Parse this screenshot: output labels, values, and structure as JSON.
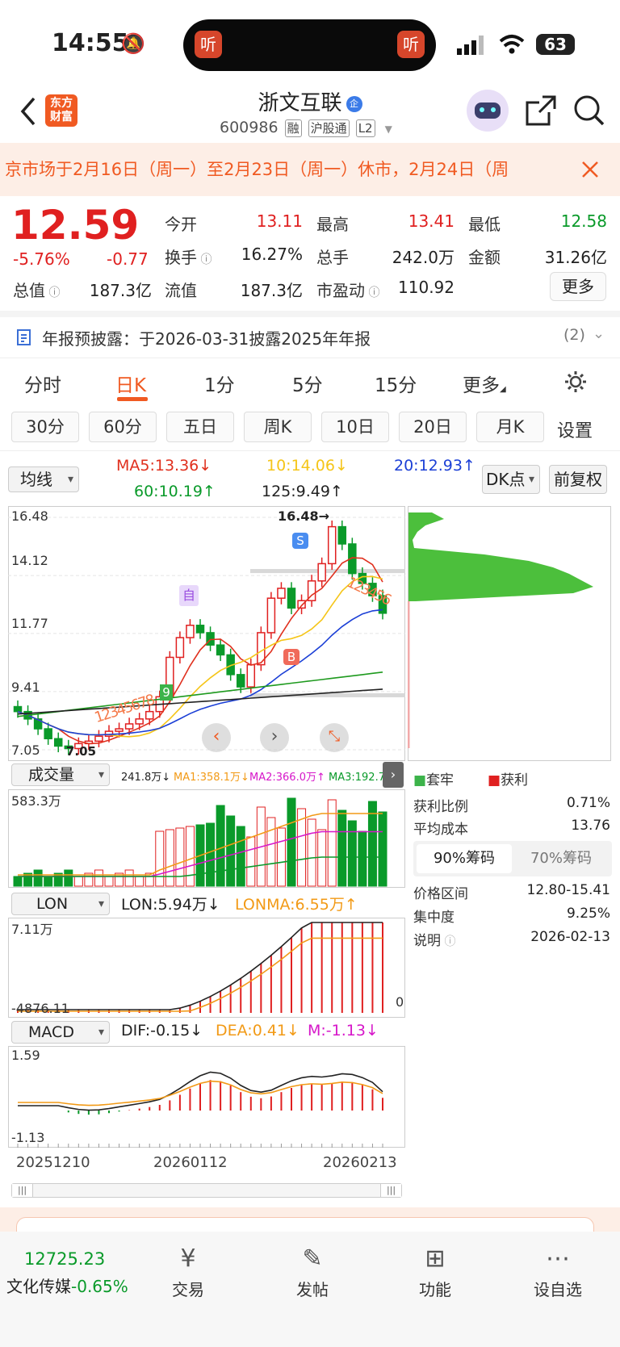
{
  "status": {
    "time": "14:55",
    "battery": "63",
    "island_left": "听",
    "island_right": "听"
  },
  "header": {
    "logo_line1": "东方",
    "logo_line2": "财富",
    "title": "浙文互联",
    "title_badge": "企",
    "code": "600986",
    "tags": [
      "融",
      "沪股通",
      "L2"
    ]
  },
  "notice": {
    "text": "京市场于2月16日（周一）至2月23日（周一）休市，2月24日（周"
  },
  "quote": {
    "price": "12.59",
    "pct": "-5.76%",
    "chg": "-0.77",
    "open_label": "今开",
    "open": "13.11",
    "high_label": "最高",
    "high": "13.41",
    "low_label": "最低",
    "low": "12.58",
    "turnover_label": "换手",
    "turnover": "16.27%",
    "volume_label": "总手",
    "volume": "242.0万",
    "amount_label": "金额",
    "amount": "31.26亿",
    "mcap_label": "总值",
    "mcap": "187.3亿",
    "float_label": "流值",
    "float": "187.3亿",
    "pe_label": "市盈动",
    "pe": "110.92",
    "more_button": "更多"
  },
  "report": {
    "text": "年报预披露：于2026-03-31披露2025年年报",
    "count": "(2)"
  },
  "period_tabs": [
    "分时",
    "日K",
    "1分",
    "5分",
    "15分",
    "更多"
  ],
  "active_period": "日K",
  "ktabs": [
    "30分",
    "60分",
    "五日",
    "周K",
    "10日",
    "20日",
    "月K"
  ],
  "settings_label": "设置",
  "ma_bar": {
    "selector": "均线",
    "ma5": "MA5:13.36↓",
    "ma10": "10:14.06↓",
    "ma20": "20:12.93↑",
    "ma60": "60:10.19↑",
    "ma125": "125:9.49↑",
    "dk": "DK点",
    "fq": "前复权"
  },
  "price_axis": [
    "16.48",
    "14.12",
    "11.77",
    "9.41",
    "7.05"
  ],
  "annotations": {
    "peak": "16.48→",
    "low": "7.05",
    "self": "自",
    "s": "S",
    "b": "B",
    "nine": "9",
    "seq_bottom": "12345678",
    "seq_top": "123456"
  },
  "volume_bar": {
    "selector": "成交量",
    "vol": "241.8万↓",
    "ma1": "MA1:358.1万↓",
    "ma2": "MA2:366.0万↑",
    "ma3": "MA3:192.7万↑",
    "max": "583.3万"
  },
  "lon_bar": {
    "selector": "LON",
    "lon": "LON:5.94万↓",
    "lonma": "LONMA:6.55万↑",
    "max": "7.11万",
    "min": "-4876.11",
    "zero": "0"
  },
  "macd_bar": {
    "selector": "MACD",
    "dif": "DIF:-0.15↓",
    "dea": "DEA:0.41↓",
    "m": "M:-1.13↓",
    "max": "1.59",
    "min": "-1.13"
  },
  "dates": [
    "20251210",
    "20260112",
    "20260213"
  ],
  "right_panel": {
    "legend_trapped": "套牢",
    "legend_profit": "获利",
    "profit_ratio_label": "获利比例",
    "profit_ratio": "0.71%",
    "avg_cost_label": "平均成本",
    "avg_cost": "13.76",
    "tab_90": "90%筹码",
    "tab_70": "70%筹码",
    "range_label": "价格区间",
    "range": "12.80-15.41",
    "conc_label": "集中度",
    "conc": "9.25%",
    "note_label": "说明",
    "note": "2026-02-13"
  },
  "bottom": {
    "index_value": "12725.23",
    "index_name": "文化传媒",
    "index_pct": "-0.65%",
    "nav": [
      "交易",
      "发帖",
      "功能",
      "设自选"
    ]
  },
  "colors": {
    "up": "#e02020",
    "down": "#0a9a2a",
    "brand": "#f05a22",
    "ma5": "#e0301e",
    "ma10": "#f5c518",
    "ma20": "#1b3fd6",
    "ma60": "#1e9a1e",
    "ma125": "#222222"
  },
  "chart_data": {
    "type": "line",
    "daily_closes_approx": [
      8.6,
      8.3,
      7.9,
      7.5,
      7.2,
      7.1,
      7.3,
      7.4,
      7.6,
      7.8,
      7.9,
      8.1,
      8.3,
      8.6,
      9.2,
      10.8,
      11.6,
      12.1,
      11.8,
      11.3,
      10.9,
      10.1,
      9.6,
      10.5,
      11.8,
      13.2,
      13.6,
      12.8,
      13.1,
      13.9,
      14.6,
      16.1,
      15.4,
      14.2,
      13.8,
      13.3,
      12.59
    ],
    "ma_lines": [
      "MA5",
      "MA10",
      "MA20",
      "MA60",
      "MA125"
    ],
    "ylim": [
      7.05,
      16.48
    ]
  }
}
